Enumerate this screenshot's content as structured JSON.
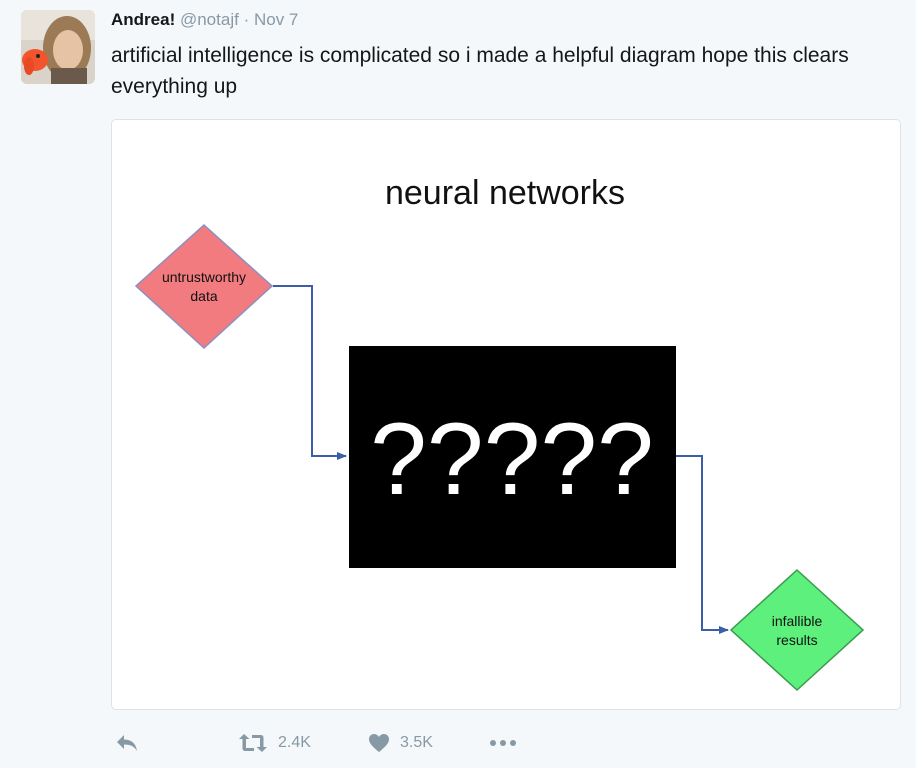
{
  "tweet": {
    "display_name": "Andrea!",
    "handle": "@notajf",
    "separator": "·",
    "time": "Nov 7",
    "text": "artificial intelligence is complicated so i made a helpful diagram hope this clears everything up"
  },
  "diagram": {
    "title": "neural networks",
    "input_label_line1": "untrustworthy",
    "input_label_line2": "data",
    "box_label": "?????",
    "output_label_line1": "infallible",
    "output_label_line2": "results",
    "colors": {
      "input_fill": "#f27b7f",
      "input_stroke": "#8b8fc2",
      "output_fill": "#5df07c",
      "output_stroke": "#3c9a4f",
      "box_fill": "#000000",
      "arrow": "#3b5ea8"
    }
  },
  "actions": {
    "reply_icon": "reply-icon",
    "retweet_icon": "retweet-icon",
    "retweet_count": "2.4K",
    "like_icon": "heart-icon",
    "like_count": "3.5K",
    "more_icon": "more-icon"
  },
  "colors": {
    "background": "#f5f8fa",
    "muted_text": "#8899a6",
    "text": "#14171a"
  }
}
